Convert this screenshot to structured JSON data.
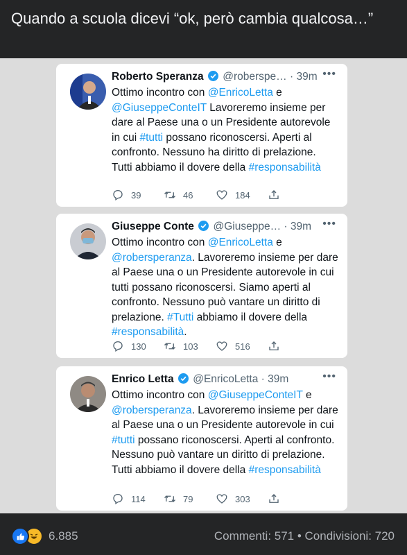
{
  "post": {
    "caption": "Quando a scuola dicevi “ok, però cambia qualcosa…”"
  },
  "tweets": [
    {
      "name": "Roberto Speranza",
      "handle": "@roberspe…",
      "time": "· 39m",
      "more": "•••",
      "t1": "Ottimo incontro con ",
      "l1": "@EnricoLetta",
      "t2": " e ",
      "l2": "@GiuseppeConteIT",
      "t3": " Lavoreremo insieme per dare al Paese una o un Presidente autorevole in cui ",
      "l3": "#tutti",
      "t4": " possano riconoscersi. Aperti al confronto. Nessuno ha diritto di prelazione. Tutti abbiamo il dovere della ",
      "l4": "#responsabilità",
      "t5": "",
      "replies": "39",
      "retweets": "46",
      "likes": "184"
    },
    {
      "name": "Giuseppe Conte",
      "handle": "@Giuseppe…",
      "time": "· 39m",
      "more": "•••",
      "t1": "Ottimo incontro con ",
      "l1": "@EnricoLetta",
      "t2": " e ",
      "l2": "@robersperanza",
      "t3": ". Lavoreremo insieme per dare al Paese una o un Presidente autorevole in cui tutti possano riconoscersi. Siamo aperti al confronto. Nessuno può vantare un diritto di prelazione. ",
      "l3": "#Tutti",
      "t4": " abbiamo il dovere della ",
      "l4": "#responsabilità",
      "t5": ".",
      "replies": "130",
      "retweets": "103",
      "likes": "516"
    },
    {
      "name": "Enrico Letta",
      "handle": "@EnricoLetta",
      "time": "· 39m",
      "more": "•••",
      "t1": "Ottimo incontro con ",
      "l1": "@GiuseppeConteIT",
      "t2": " e ",
      "l2": "@robersperanza",
      "t3": ". Lavoreremo insieme per dare al Paese una o un Presidente autorevole in cui ",
      "l3": "#tutti",
      "t4": " possano riconoscersi. Aperti al confronto. Nessuno può vantare un diritto di prelazione. Tutti abbiamo il dovere della ",
      "l4": "#responsabilità",
      "t5": "",
      "replies": "114",
      "retweets": "79",
      "likes": "303"
    }
  ],
  "footer": {
    "reactions": "6.885",
    "stats": "Commenti: 571 • Condivisioni: 720"
  },
  "colors": {
    "link": "#1d9bf0",
    "verified": "#1d9bf0",
    "bar": "#242526",
    "card": "#ffffff"
  }
}
